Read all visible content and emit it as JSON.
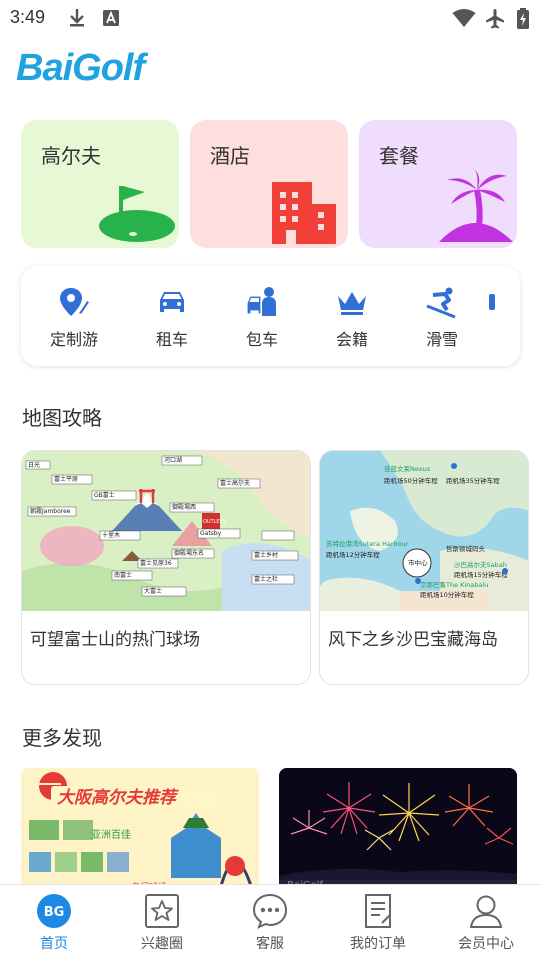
{
  "status_bar": {
    "time": "3:49"
  },
  "logo": {
    "text_part1": "Bai",
    "text_part2": "Golf"
  },
  "categories": [
    {
      "label": "高尔夫",
      "bg": "#e6f8d4",
      "icon": "golf-green-icon"
    },
    {
      "label": "酒店",
      "bg": "#ffdede",
      "icon": "hotel-building-icon"
    },
    {
      "label": "套餐",
      "bg": "#f0dcfc",
      "icon": "palm-island-icon"
    }
  ],
  "services": [
    {
      "label": "定制游",
      "icon": "map-pin-pen-icon"
    },
    {
      "label": "租车",
      "icon": "car-icon"
    },
    {
      "label": "包车",
      "icon": "driver-car-icon"
    },
    {
      "label": "会籍",
      "icon": "crown-icon"
    },
    {
      "label": "滑雪",
      "icon": "ski-icon"
    }
  ],
  "sections": {
    "map_guide": "地图攻略",
    "more": "更多发现"
  },
  "map_cards": [
    {
      "caption": "可望富士山的热门球场",
      "labels": [
        "日光",
        "河口湖",
        "富士高尔夫",
        "朝霧Jamboree",
        "富士平原",
        "GB富士",
        "十里木",
        "御殿場西",
        "南富士",
        "御殿場东名",
        "富士乡村",
        "大富士",
        "GOTEMBA PREMIUM OUTLETS",
        "Gatsby",
        "富士之杜",
        "富士见原36"
      ]
    },
    {
      "caption": "风下之乡沙巴宝藏海岛",
      "labels": [
        "佳蓝文莱Nexus",
        "距机场50分钟车程",
        "距机场35分钟车程",
        "苏特拉港湾Sutera Harbour",
        "距机场12分钟车程",
        "市中心",
        "哲斯顿城码头",
        "沙巴高尔夫Sabah",
        "距机场15分钟车程",
        "京那巴鲁The Kinabalu",
        "距机场10分钟车程"
      ]
    }
  ],
  "discover_cards": [
    {
      "title": "大阪高尔夫推荐",
      "sub1": "亚洲百佳",
      "sub2": "名门球场"
    },
    {
      "caption": "BaiGolf"
    }
  ],
  "bottom_nav": [
    {
      "label": "首页",
      "icon": "home-bg-icon",
      "active": true,
      "badge": "BG"
    },
    {
      "label": "兴趣圈",
      "icon": "star-square-icon"
    },
    {
      "label": "客服",
      "icon": "chat-bubble-icon"
    },
    {
      "label": "我的订单",
      "icon": "order-doc-icon"
    },
    {
      "label": "会员中心",
      "icon": "user-icon"
    }
  ],
  "colors": {
    "accent": "#1e88e5",
    "golf_green": "#28b24b",
    "hotel_red": "#f04038",
    "package_purple": "#c233e0"
  }
}
